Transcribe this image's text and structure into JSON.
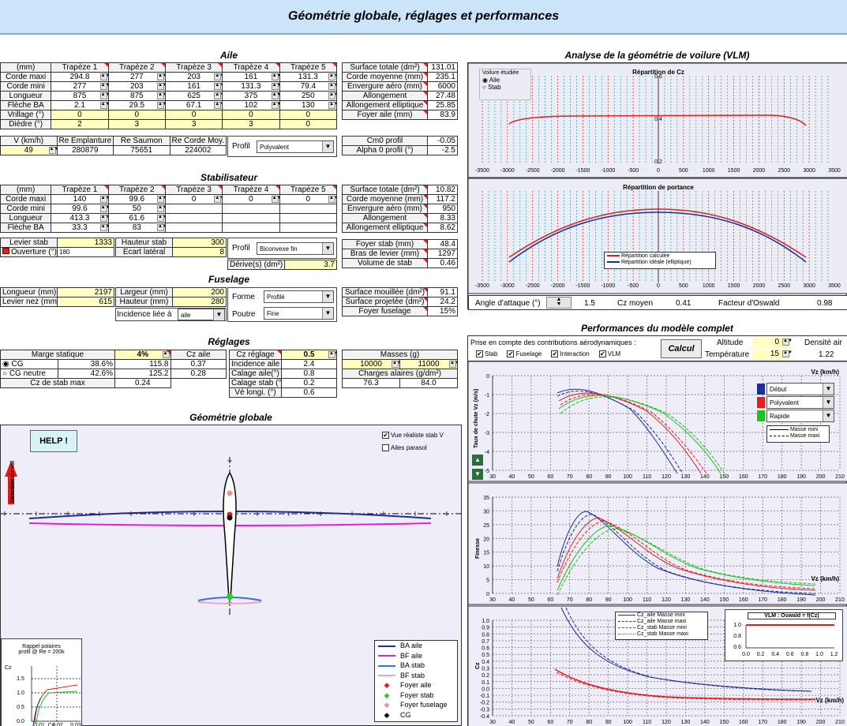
{
  "banner": "Géométrie globale, réglages et performances",
  "aile": {
    "title": "Aile",
    "headers": [
      "(mm)",
      "Trapèze 1",
      "Trapèze 2",
      "Trapèze 3",
      "Trapèze 4",
      "Trapèze 5"
    ],
    "rows": [
      {
        "label": "Corde maxi",
        "vals": [
          "294.8",
          "277",
          "203",
          "161",
          "131.3"
        ]
      },
      {
        "label": "Corde mini",
        "vals": [
          "277",
          "203",
          "161",
          "131.3",
          "79.4"
        ]
      },
      {
        "label": "Longueur",
        "vals": [
          "875",
          "875",
          "625",
          "375",
          "250"
        ]
      },
      {
        "label": "Flèche BA",
        "vals": [
          "2.1",
          "29.5",
          "67.1",
          "102",
          "130"
        ]
      },
      {
        "label": "Vrillage (°)",
        "vals": [
          "0",
          "0",
          "0",
          "0",
          "0"
        ]
      },
      {
        "label": "Dièdre (°)",
        "vals": [
          "2",
          "3",
          "3",
          "3",
          "0"
        ]
      }
    ],
    "re_headers": [
      "V (km/h)",
      "Re Emplanture",
      "Re Saumon",
      "Re Corde Moy."
    ],
    "re_vals": [
      "49",
      "280879",
      "75651",
      "224002"
    ],
    "profil_label": "Profil",
    "profil_value": "Polyvalent",
    "stats": [
      [
        "Surface totale (dm²)",
        "131.01"
      ],
      [
        "Corde moyenne (mm)",
        "235.1"
      ],
      [
        "Envergure aéro (mm)",
        "6000"
      ],
      [
        "Allongement",
        "27.48"
      ],
      [
        "Allongement elliptique",
        "25.85"
      ],
      [
        "Foyer aile (mm)",
        "83.9"
      ]
    ],
    "cm0": [
      [
        "Cm0 profil",
        "-0.05"
      ],
      [
        "Alpha 0 profil (°)",
        "-2.5"
      ]
    ]
  },
  "stab": {
    "title": "Stabilisateur",
    "headers": [
      "(mm)",
      "Trapèze 1",
      "Trapèze 2",
      "Trapèze 3",
      "Trapèze 4",
      "Trapèze 5"
    ],
    "rows": [
      {
        "label": "Corde maxi",
        "vals": [
          "140",
          "99.6",
          "0",
          "0",
          "0"
        ]
      },
      {
        "label": "Corde mini",
        "vals": [
          "99.6",
          "50",
          "",
          "",
          ""
        ]
      },
      {
        "label": "Longueur",
        "vals": [
          "413.3",
          "61.6",
          "",
          "",
          ""
        ]
      },
      {
        "label": "Flèche BA",
        "vals": [
          "33.3",
          "83",
          "",
          "",
          ""
        ]
      }
    ],
    "levier_label": "Levier stab",
    "levier_val": "1333",
    "ouverture_label": "Ouverture (°)",
    "ouverture_val": "180",
    "hauteur_label": "Hauteur stab",
    "hauteur_val": "300",
    "ecart_label": "Ecart latéral",
    "ecart_val": "8",
    "profil_label": "Profil",
    "profil_value": "Biconvexe fin",
    "derive_label": "Dérive(s) (dm²)",
    "derive_val": "3.7",
    "stats": [
      [
        "Surface totale (dm²)",
        "10.82"
      ],
      [
        "Corde moyenne (mm)",
        "117.2"
      ],
      [
        "Envergure aéro (mm)",
        "950"
      ],
      [
        "Allongement",
        "8.33"
      ],
      [
        "Allongement elliptique",
        "8.62"
      ]
    ],
    "stats2": [
      [
        "Foyer stab (mm)",
        "48.4"
      ],
      [
        "Bras de levier (mm)",
        "1297"
      ],
      [
        "Volume de stab",
        "0.46"
      ]
    ]
  },
  "fuselage": {
    "title": "Fuselage",
    "longueur_label": "Longueur (mm)",
    "longueur_val": "2197",
    "levier_label": "Levier nez (mm)",
    "levier_val": "615",
    "largeur_label": "Largeur (mm)",
    "largeur_val": "200",
    "hauteur_label": "Hauteur (mm)",
    "hauteur_val": "280",
    "forme_label": "Forme",
    "forme_val": "Profilé",
    "poutre_label": "Poutre",
    "poutre_val": "Fine",
    "incidence_label": "Incidence liée à",
    "incidence_val": "aile",
    "stats": [
      [
        "Surface mouillée (dm²)",
        "91.1"
      ],
      [
        "Surface projetée (dm²)",
        "24.2"
      ],
      [
        "Foyer fuselage",
        "15%"
      ]
    ]
  },
  "reglages": {
    "title": "Réglages",
    "marge_label": "Marge statique",
    "marge_val": "4%",
    "cz_aile_label": "Cz aile",
    "cg_label": "CG",
    "cg_pct": "38.6%",
    "cg_mm": "115.8",
    "cg_cz": "0.37",
    "cgn_label": "CG neutre",
    "cgn_pct": "42.6%",
    "cgn_mm": "125.2",
    "cgn_cz": "0.28",
    "czmax_label": "Cz de stab max",
    "czmax_val": "0.24",
    "cz_reglage_label": "Cz réglage",
    "cz_reglage_val": "0.5",
    "rows2": [
      [
        "Incidence aile (°)",
        "2.4"
      ],
      [
        "Calage aile(°)",
        "0.8"
      ],
      [
        "Calage stab (°)",
        "0.2"
      ],
      [
        "Vé longi. (°)",
        "0.6"
      ]
    ],
    "masses_label": "Masses (g)",
    "masse1": "10000",
    "masse2": "11000",
    "charges_label": "Charges alaires (g/dm²)",
    "charge1": "76.3",
    "charge2": "84.0"
  },
  "geometrie": {
    "title": "Géométrie globale",
    "help": "HELP !",
    "direction": "Direction du vol",
    "cb1": "Vue réaliste stab V",
    "cb2": "Ailes parasol",
    "legend": [
      "BA aile",
      "BF aile",
      "BA stab",
      "BF stab",
      "Foyer aile",
      "Foyer stab",
      "Foyer fuselage",
      "CG"
    ],
    "polar_title1": "Rappel polaires",
    "polar_title2": "profil @ Re = 200k",
    "polar_ylabel": "Cz",
    "polar_yticks": [
      "1.5",
      "1.0",
      "0.5",
      "0.0"
    ],
    "polar_xticks": [
      "0.01",
      "0.02",
      "0.03"
    ],
    "polar_xlabel": "Cx"
  },
  "vlm": {
    "title": "Analyse de la géométrie de voilure (VLM)",
    "voilure_label": "Voilure étudiée",
    "opt_aile": "Aile",
    "opt_stab": "Stab",
    "chart1_title": "Répartition de Cz",
    "chart2_title": "Répartition de portance",
    "legend1": "Répartition calculée",
    "legend2": "Répartition idéale (elliptique)",
    "xticks": [
      "-3500",
      "-3000",
      "-2500",
      "-2000",
      "-1500",
      "-1000",
      "-500",
      "0",
      "500",
      "1000",
      "1500",
      "2000",
      "2500",
      "3000",
      "3500"
    ],
    "ylabels1": [
      "0.6",
      "0.4",
      "0.2"
    ],
    "angle_label": "Angle d'attaque (°)",
    "angle_val": "1.5",
    "czm_label": "Cz moyen",
    "czm_val": "0.41",
    "oswald_label": "Facteur d'Oswald",
    "oswald_val": "0.98"
  },
  "perf": {
    "title": "Performances du modèle complet",
    "prise_label": "Prise en compte des contributions aérodynamiques :",
    "calcul": "Calcul",
    "checks": [
      "Stab",
      "Fuselage",
      "Interaction",
      "VLM"
    ],
    "alt_label": "Altitude",
    "alt_val": "0",
    "temp_label": "Température",
    "temp_val": "15",
    "dens_label": "Densité air",
    "dens_val": "1.22",
    "xticks": [
      "30",
      "40",
      "50",
      "60",
      "70",
      "80",
      "90",
      "100",
      "110",
      "120",
      "130",
      "140",
      "150",
      "160",
      "170",
      "180",
      "190",
      "200",
      "210"
    ],
    "vz_label": "Vz (km/h)",
    "c1_ylabel": "Taux de chute Vz (m/s)",
    "c1_yticks": [
      "0",
      "-1",
      "-2",
      "-3",
      "-4",
      "-5"
    ],
    "profiles": [
      "Début",
      "Polyvalent",
      "Rapide"
    ],
    "masse_mini": "Masse mini",
    "masse_maxi": "Masse maxi",
    "c2_ylabel": "Finesse",
    "c2_yticks": [
      "35",
      "30",
      "25",
      "20",
      "15",
      "10",
      "5",
      "0"
    ],
    "c3_ylabel": "Cz",
    "c3_yticks": [
      "1.0",
      "0.9",
      "0.8",
      "0.7",
      "0.6",
      "0.5",
      "0.4",
      "0.3",
      "0.2",
      "0.1",
      "0.0",
      "-0.1",
      "-0.2",
      "-0.3",
      "-0.4"
    ],
    "c3_legend": [
      "Cz_aile Masse mini",
      "Cz_aile Masse maxi",
      "Cz_stab Masse mini",
      "Cz_stab Masse maxi"
    ],
    "oswald_title": "VLM : Oswald = f(Cz)",
    "oswald_yticks": [
      "1.0",
      "0.8",
      "0.6"
    ],
    "oswald_xticks": [
      "0.0",
      "0.2",
      "0.4",
      "0.6",
      "0.8",
      "1.0",
      "1.2"
    ]
  },
  "colors": {
    "blue": "#1c2e99",
    "red": "#e02020",
    "green": "#20c020",
    "magenta": "#e020e0"
  }
}
